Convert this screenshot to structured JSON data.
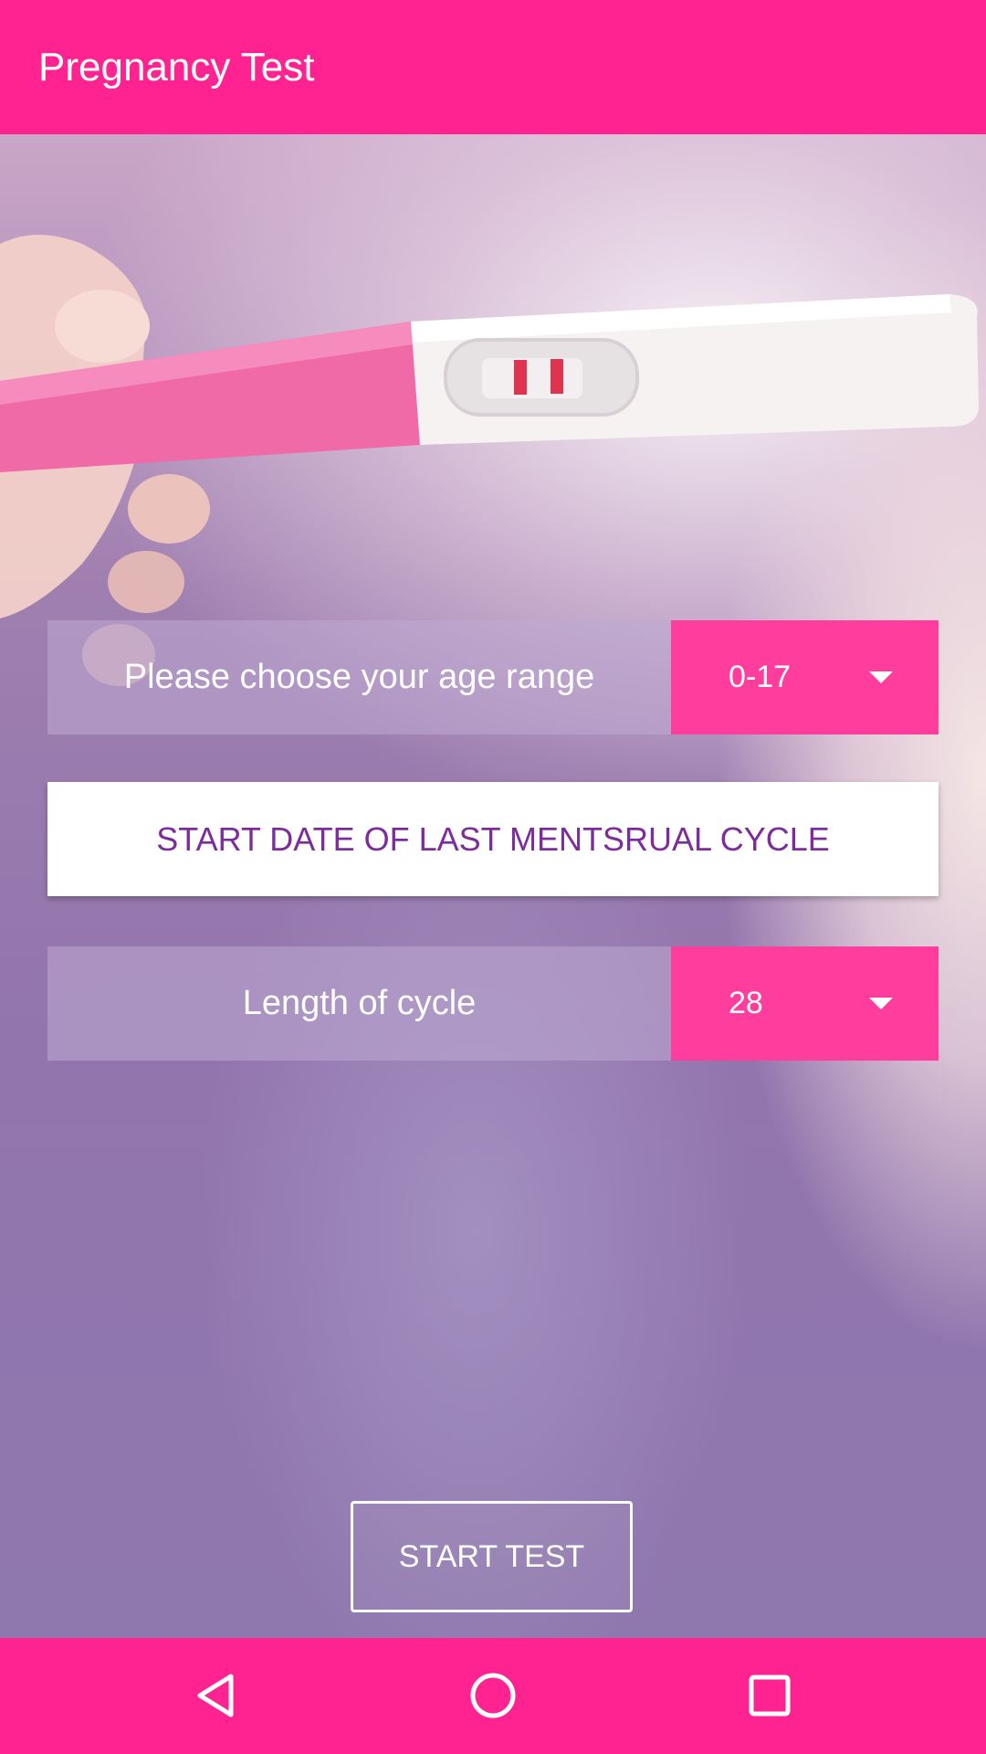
{
  "app_bar": {
    "title": "Pregnancy Test"
  },
  "form": {
    "age_range": {
      "label": "Please choose your age range",
      "selected": "0-17"
    },
    "date_button_label": "START DATE OF LAST MENTSRUAL CYCLE",
    "cycle_length": {
      "label": "Length of cycle",
      "selected": "28"
    },
    "start_test_label": "START TEST"
  },
  "nav_bar": {
    "back_icon": "back-triangle-icon",
    "home_icon": "home-circle-icon",
    "recent_icon": "recent-apps-square-icon"
  },
  "colors": {
    "accent": "#fe2390",
    "select_bg": "#ff3d9c",
    "date_text": "#7d2c9c"
  }
}
